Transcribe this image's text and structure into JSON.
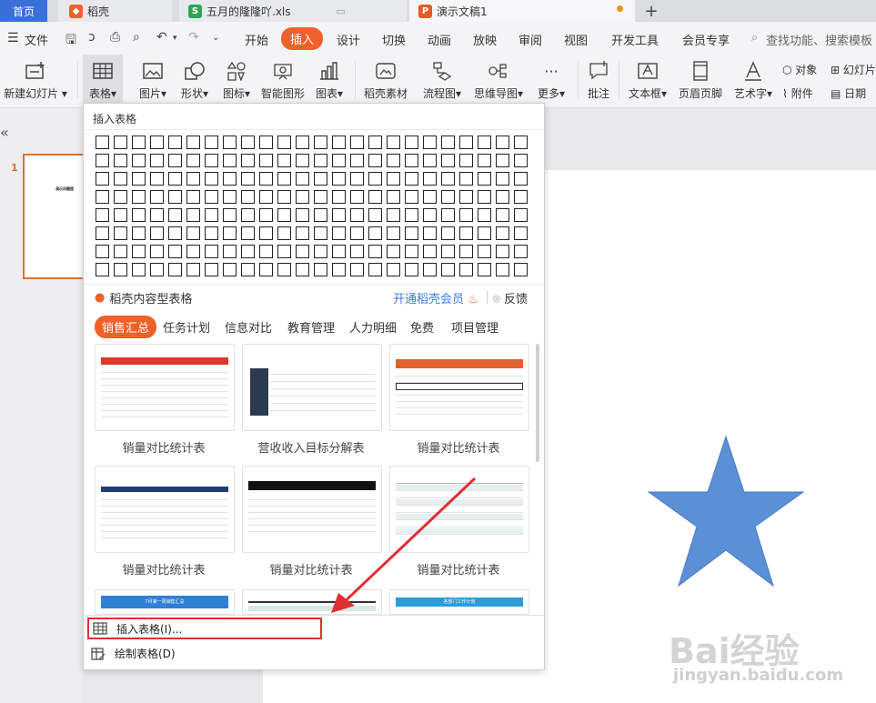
{
  "tabs": [
    {
      "label": "首页"
    },
    {
      "label": "稻壳"
    },
    {
      "label": "五月的隆隆吖.xls"
    },
    {
      "label": "演示文稿1"
    }
  ],
  "tab_add": "+",
  "menu": {
    "file": "文件",
    "items": [
      "开始",
      "插入",
      "设计",
      "切换",
      "动画",
      "放映",
      "审阅",
      "视图",
      "开发工具",
      "会员专享"
    ],
    "search": "查找功能、搜索模板"
  },
  "ribbon": [
    {
      "label": "新建幻灯片 ▾"
    },
    {
      "label": "表格▾"
    },
    {
      "label": "图片▾"
    },
    {
      "label": "形状▾"
    },
    {
      "label": "图标▾"
    },
    {
      "label": "智能图形"
    },
    {
      "label": "图表▾"
    },
    {
      "label": "稻壳素材"
    },
    {
      "label": "流程图▾"
    },
    {
      "label": "思维导图▾"
    },
    {
      "label": "更多▾"
    },
    {
      "label": "批注"
    },
    {
      "label": "文本框▾"
    },
    {
      "label": "页眉页脚"
    },
    {
      "label": "艺术字▾"
    }
  ],
  "ribbon_small": [
    "对象",
    "幻灯片",
    "附件",
    "日期"
  ],
  "left": {
    "collapse": "«",
    "slide_number": "1",
    "thumb_text": "演示问题提"
  },
  "dropdown": {
    "insert_table_title": "插入表格",
    "daoke_title": "稻壳内容型表格",
    "vip_link": "开通稻壳会员",
    "feedback": "反馈",
    "categories": [
      "销售汇总",
      "任务计划",
      "信息对比",
      "教育管理",
      "人力明细",
      "免费",
      "项目管理"
    ],
    "templates": [
      {
        "label": "销量对比统计表"
      },
      {
        "label": "营收收入目标分解表"
      },
      {
        "label": "销量对比统计表"
      },
      {
        "label": "销量对比统计表"
      },
      {
        "label": "销量对比统计表"
      },
      {
        "label": "销量对比统计表"
      }
    ],
    "bottom_cards": [
      "7月第一周销售汇总",
      "",
      "各部门工作计划"
    ],
    "insert_table_action": "插入表格(I)...",
    "draw_table_action": "绘制表格(D)"
  },
  "colors": {
    "accent": "#f0602a",
    "highlight": "#e03030",
    "star": "#5b8fd6"
  },
  "watermark": {
    "brand": "Bai经验",
    "url": "jingyan.baidu.com"
  }
}
